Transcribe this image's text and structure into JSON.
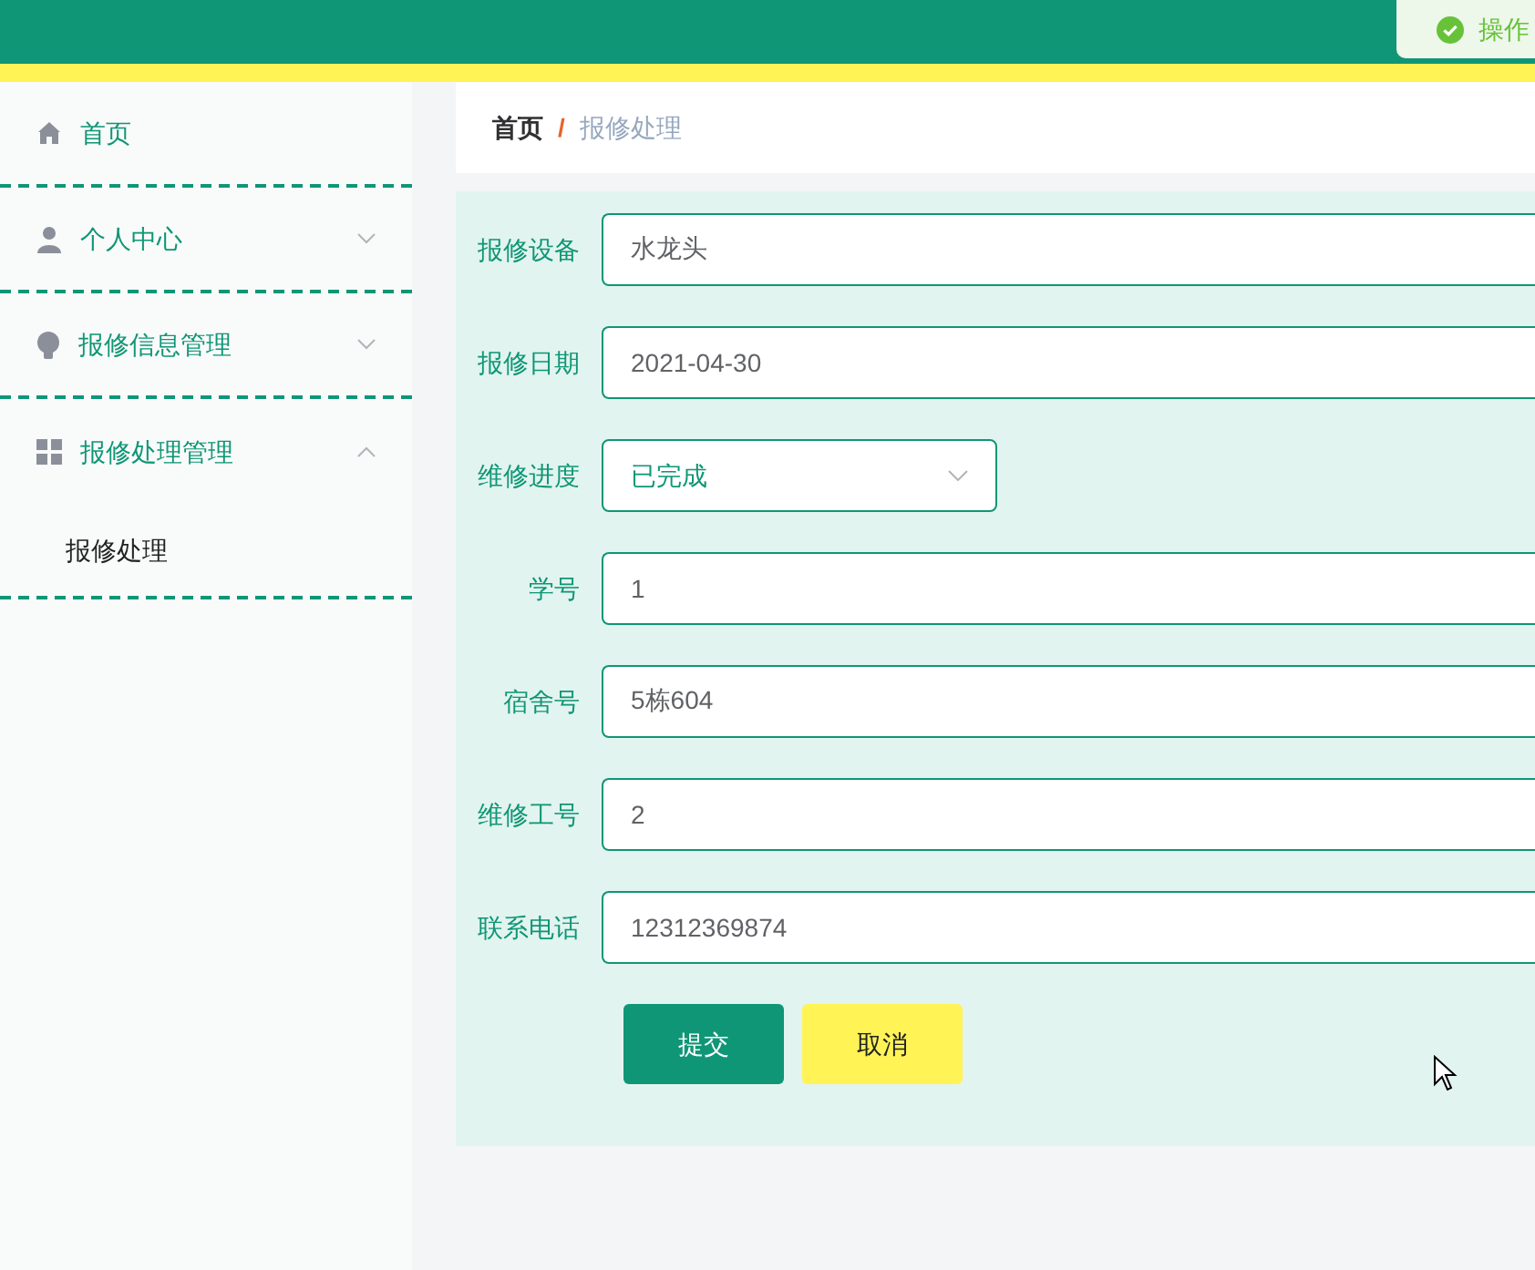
{
  "toast": {
    "kind": "success",
    "text": "操作"
  },
  "sidebar": {
    "items": [
      {
        "label": "首页",
        "kind": "link"
      },
      {
        "label": "个人中心",
        "kind": "menu",
        "expanded": false
      },
      {
        "label": "报修信息管理",
        "kind": "menu",
        "expanded": false
      },
      {
        "label": "报修处理管理",
        "kind": "menu",
        "expanded": true,
        "children": [
          {
            "label": "报修处理"
          }
        ]
      }
    ]
  },
  "breadcrumb_separator": "/",
  "breadcrumb": [
    {
      "label": "首页",
      "current": false
    },
    {
      "label": "报修处理",
      "current": true
    }
  ],
  "form": {
    "fields": [
      {
        "label": "报修设备",
        "kind": "text",
        "value": "水龙头"
      },
      {
        "label": "报修日期",
        "kind": "text",
        "value": "2021-04-30"
      },
      {
        "label": "维修进度",
        "kind": "select",
        "value": "已完成"
      },
      {
        "label": "学号",
        "kind": "text",
        "value": "1"
      },
      {
        "label": "宿舍号",
        "kind": "text",
        "value": "5栋604"
      },
      {
        "label": "维修工号",
        "kind": "text",
        "value": "2"
      },
      {
        "label": "联系电话",
        "kind": "text",
        "value": "12312369874"
      }
    ],
    "buttons": [
      {
        "label": "提交",
        "kind": "primary"
      },
      {
        "label": "取消",
        "kind": "secondary"
      }
    ]
  }
}
